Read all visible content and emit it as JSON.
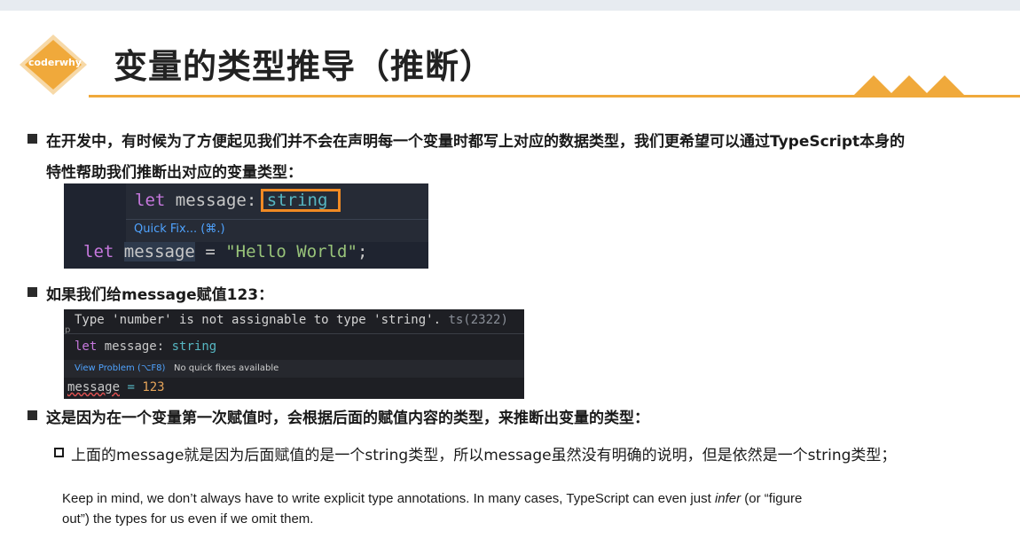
{
  "header": {
    "logo_text": "coderwhy",
    "title": "变量的类型推导（推断）",
    "accent_color": "#f0a93b"
  },
  "bullets": {
    "b1_line1": "在开发中，有时候为了方便起见我们并不会在声明每一个变量时都写上对应的数据类型，我们更希望可以通过TypeScript本身的",
    "b1_line2": "特性帮助我们推断出对应的变量类型：",
    "b2": "如果我们给message赋值123：",
    "b3": "这是因为在一个变量第一次赋值时，会根据后面的赋值内容的类型，来推断出变量的类型：",
    "sub1": "上面的message就是因为后面赋值的是一个string类型，所以message虽然没有明确的说明，但是依然是一个string类型；"
  },
  "code1": {
    "hover_let": "let",
    "hover_name": "message:",
    "hover_type": "string",
    "quick_fix": "Quick Fix... (⌘.)",
    "line_let": "let",
    "line_name": "message",
    "line_eq": "=",
    "line_value": "\"Hello World\"",
    "line_semi": ";"
  },
  "code2": {
    "error_text": "Type 'number' is not assignable to type 'string'.",
    "error_code": "ts(2322)",
    "hover_let": "let",
    "hover_name": "message:",
    "hover_type": "string",
    "view_problem": "View Problem (⌥F8)",
    "no_fixes": "No quick fixes available",
    "line_name": "message",
    "line_eq": "=",
    "line_value": "123"
  },
  "note": {
    "line1_a": "Keep in mind, we don’t always have to write explicit type annotations. In many cases, TypeScript can even just ",
    "line1_em": "infer",
    "line1_b": " (or “figure",
    "line2": "out”) the types for us even if we omit them."
  }
}
